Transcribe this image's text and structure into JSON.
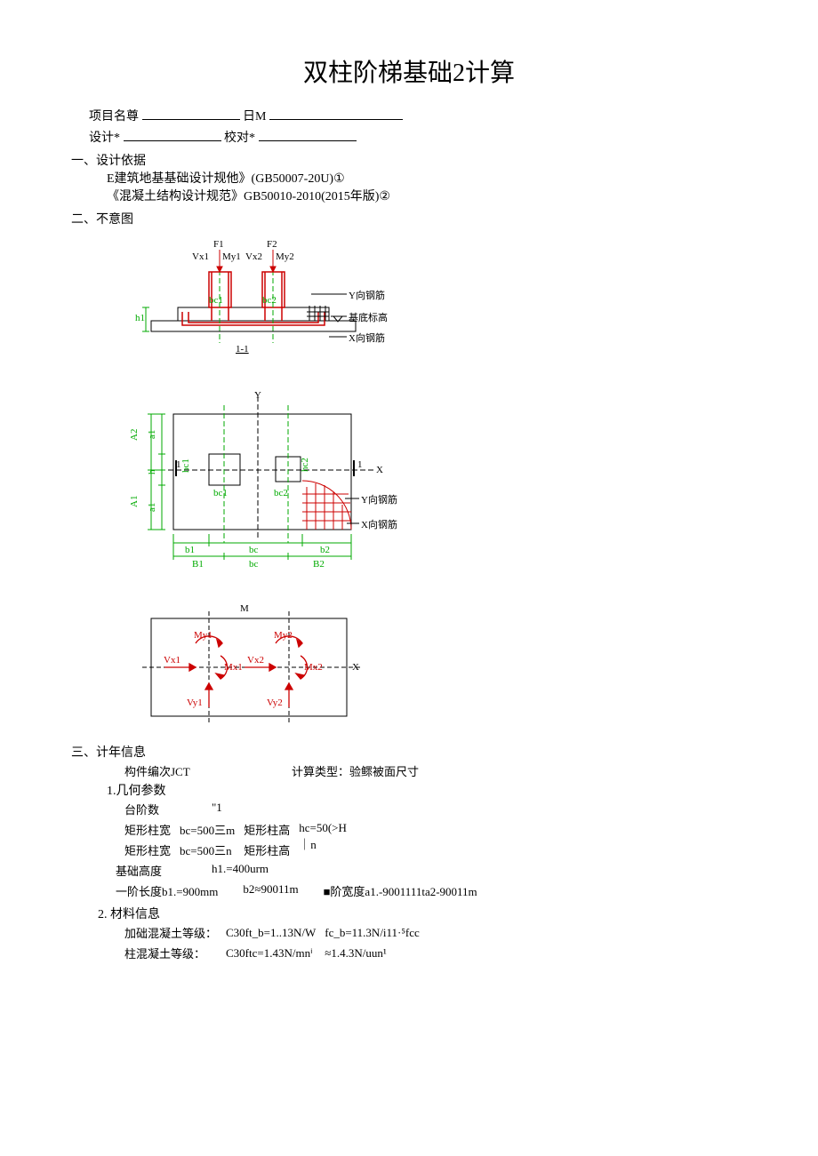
{
  "title": "双柱阶梯基础2计算",
  "header": {
    "proj_label": "项目名尊",
    "date_label": "日M",
    "design_label": "设计*",
    "check_label": "校对*"
  },
  "s1": {
    "heading": "一、设计依据",
    "line1": "E建筑地基基础设计规他》(GB50007-20U)①",
    "line2": "《混凝土结构设计规范》GB50010-2010(2015年版)②"
  },
  "s2": {
    "heading": "二、不意图",
    "labels": {
      "F1": "F1",
      "F2": "F2",
      "Vx1t": "Vx1",
      "My1": "My1",
      "Vx2t": "Vx2",
      "My2": "My2",
      "bc1": "bc1",
      "bc2": "bc2",
      "y_rebar": "Y向钢筋",
      "base_elev": "基底标高",
      "x_rebar": "X向钢筋",
      "h1": "h1",
      "sec11": "1-1",
      "Y": "Y",
      "X": "X",
      "A1": "A1",
      "A2": "A2",
      "a1": "a1",
      "a2": "a1",
      "h": "h",
      "one": "1",
      "hc1": "hc1",
      "hc2": "hc2",
      "b1": "b1",
      "b2": "b2",
      "bc": "bc",
      "B1": "B1",
      "B2": "B2",
      "y_rebar2": "Y向钢筋",
      "x_rebar2": "X向钢筋",
      "M": "M",
      "My1b": "My1",
      "My2b": "My2",
      "Mx1": "Mx1",
      "Mx2": "Mx2",
      "Vx1": "Vx1",
      "Vx2": "Vx2",
      "Vy1": "Vy1",
      "Vy2": "Vy2",
      "Xb": "X"
    }
  },
  "s3": {
    "heading": "三、计年信息",
    "comp_id_label": "构件编次JCT",
    "calc_type_label": "计算类型：",
    "calc_type_value": "验鳏被面尺寸",
    "geom_heading": "1.几何参数",
    "geom": {
      "steps_label": "台阶数",
      "steps_value": "\"1",
      "rect_w_label": "矩形柱宽",
      "bc1": "bc=500三m",
      "rect_h_label": "矩形柱高",
      "hc1": "hc=50(>H",
      "bc2": "bc=500三n",
      "hc2_suffix": "｜n",
      "base_h_label": "基础高度",
      "base_h_value": "h1.=400urm",
      "len1_label": "一阶长度b1.=900mm",
      "b2": "b2≈90011m",
      "step_w_label": "■阶宽度a1.-9001111ta2-90011m"
    },
    "mat_heading": "2. 材料信息",
    "mat": {
      "found_conc_label": "加础混凝土等级：",
      "found_conc_v1": "C30ft_b=1..13N/W",
      "found_conc_v2": "fc_b=11.3N/i11·⁵fcc",
      "col_conc_label": "柱混凝土等级：",
      "col_conc_v1": "C30ftc=1.43N/mnⁱ",
      "col_conc_v2": "≈1.4.3N/uun¹"
    }
  }
}
